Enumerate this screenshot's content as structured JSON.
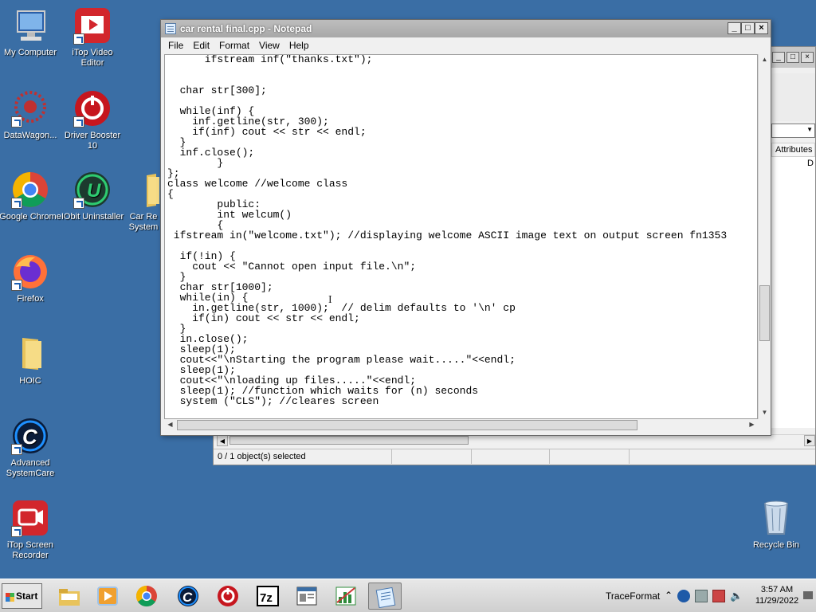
{
  "desktop": {
    "icons": [
      {
        "label": "My Computer"
      },
      {
        "label": "iTop Video Editor"
      },
      {
        "label": "DataWagon..."
      },
      {
        "label": "Driver Booster 10"
      },
      {
        "label": "Google Chrome"
      },
      {
        "label": "IObit Uninstaller"
      },
      {
        "label": "Car Re System"
      },
      {
        "label": "Firefox"
      },
      {
        "label": "HOIC"
      },
      {
        "label": "Advanced SystemCare"
      },
      {
        "label": "iTop Screen Recorder"
      },
      {
        "label": "Recycle Bin"
      }
    ]
  },
  "explorer": {
    "column_header": "Attributes",
    "list_fragment": "D",
    "status": {
      "selection": "0 / 1 object(s) selected"
    }
  },
  "notepad": {
    "title": "car rental final.cpp - Notepad",
    "menu": [
      "File",
      "Edit",
      "Format",
      "View",
      "Help"
    ],
    "code": "      ifstream inf(\"thanks.txt\");\n\n\n  char str[300];\n\n  while(inf) {\n    inf.getline(str, 300);\n    if(inf) cout << str << endl;\n  }\n  inf.close();\n        }\n};\nclass welcome //welcome class\n{\n        public:\n        int welcum()\n        {\n ifstream in(\"welcome.txt\"); //displaying welcome ASCII image text on output screen fn1353\n\n  if(!in) {\n    cout << \"Cannot open input file.\\n\";\n  }\n  char str[1000];\n  while(in) {\n    in.getline(str, 1000);  // delim defaults to '\\n' cp\n    if(in) cout << str << endl;\n  }\n  in.close();\n  sleep(1);\n  cout<<\"\\nStarting the program please wait.....\"<<endl;\n  sleep(1);\n  cout<<\"\\nloading up files.....\"<<endl;\n  sleep(1); //function which waits for (n) seconds\n  system (\"CLS\"); //cleares screen"
  },
  "taskbar": {
    "start_label": "Start",
    "tray_label": "TraceFormat",
    "time": "3:57 AM",
    "date": "11/29/2022"
  }
}
